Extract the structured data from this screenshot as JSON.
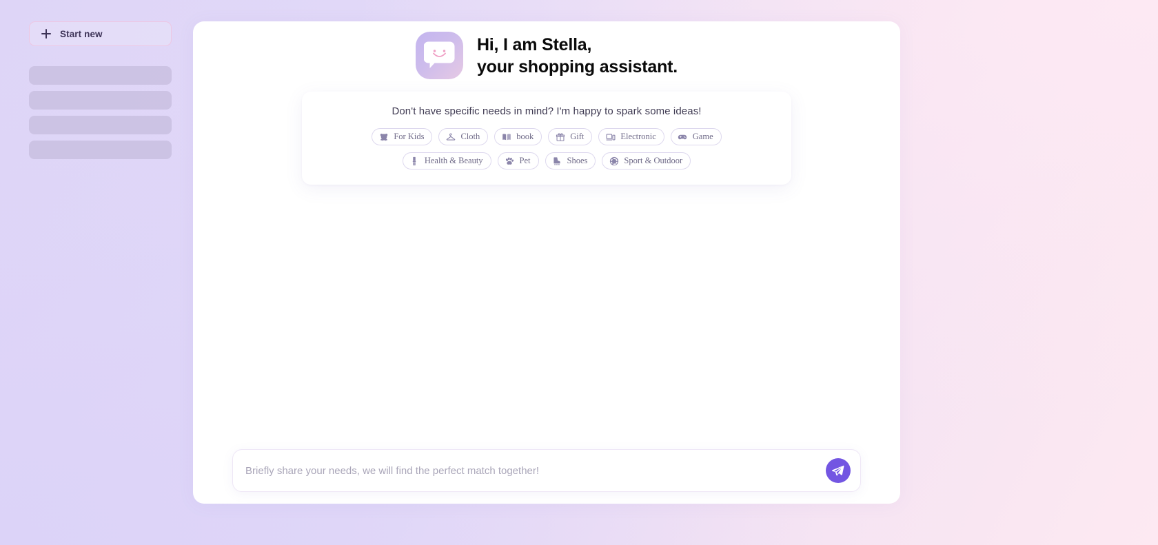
{
  "sidebar": {
    "start_new_label": "Start new",
    "skeleton_count": 4
  },
  "hero": {
    "logo_icon": "smiley-chat-bubble-logo",
    "title_line1": "Hi, I am Stella,",
    "title_line2": "your shopping assistant."
  },
  "suggestions": {
    "prompt": "Don't have specific needs in mind? I'm happy to spark some ideas!",
    "rows": [
      [
        {
          "label": "For Kids",
          "icon": "teddy-bear-icon"
        },
        {
          "label": "Cloth",
          "icon": "clothes-hanger-icon"
        },
        {
          "label": "book",
          "icon": "open-book-icon"
        },
        {
          "label": "Gift",
          "icon": "gift-box-icon"
        },
        {
          "label": "Electronic",
          "icon": "laptop-icon"
        },
        {
          "label": "Game",
          "icon": "gamepad-icon"
        }
      ],
      [
        {
          "label": "Health & Beauty",
          "icon": "lipstick-icon"
        },
        {
          "label": "Pet",
          "icon": "paw-print-icon"
        },
        {
          "label": "Shoes",
          "icon": "roller-skate-icon"
        },
        {
          "label": "Sport & Outdoor",
          "icon": "basketball-icon"
        }
      ]
    ]
  },
  "composer": {
    "placeholder": "Briefly share your needs, we will find the perfect match together!",
    "value": "",
    "send_icon": "paper-plane-icon"
  },
  "colors": {
    "accent_purple": "#7356e2",
    "logo_gradient_start": "#c4b5ef",
    "logo_gradient_end": "#e6c9e4",
    "smiley_pink": "#ef9fc4",
    "panel_bg": "#ffffff",
    "chip_border": "#ddd8ee",
    "chip_text": "#6f6a88",
    "skeleton": "#c8bedf",
    "bg_lavender": "#ded5f7",
    "bg_pink": "#fde9f2"
  }
}
